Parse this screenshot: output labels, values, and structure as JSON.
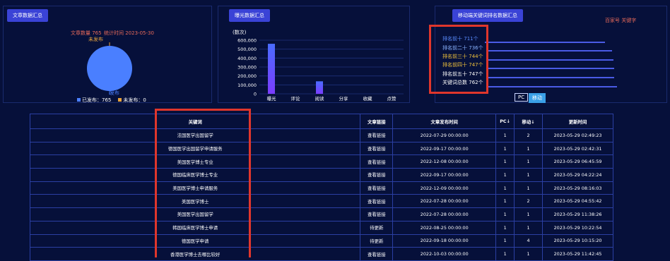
{
  "panels": {
    "articles": {
      "title": "文章数据汇总",
      "count_text": "文章数量 765",
      "stat_time_text": "统计时间 2023-05-30",
      "unpublished_label": "未发布",
      "published_label": "发布",
      "legend": [
        {
          "label": "已发布：765",
          "color": "#4a7fff"
        },
        {
          "label": "未发布：0",
          "color": "#e8a23a"
        }
      ],
      "published_count": 765,
      "unpublished_count": 0
    },
    "exposure": {
      "title": "曝光数据汇总",
      "unit_label": "(数次)"
    },
    "mobile": {
      "title": "移动端关键词排名数据汇总",
      "source_label": "百家号 关键字",
      "ranks": [
        {
          "label": "排名前十",
          "value": "711个",
          "label_color": "#5a8cff",
          "value_color": "#5a8cff"
        },
        {
          "label": "排名前二十",
          "value": "736个",
          "label_color": "#8ab3ff",
          "value_color": "#8ab3ff"
        },
        {
          "label": "排名前三十",
          "value": "744个",
          "label_color": "#f0c23b",
          "value_color": "#f0c23b"
        },
        {
          "label": "排名前四十",
          "value": "747个",
          "label_color": "#f0c23b",
          "value_color": "#f0c23b"
        },
        {
          "label": "排名前五十",
          "value": "747个",
          "label_color": "#ffffff",
          "value_color": "#ffffff"
        },
        {
          "label": "关键词总数",
          "value": "762个",
          "label_color": "#ffffff",
          "value_color": "#ffffff"
        }
      ],
      "tab_pc": "PC",
      "tab_mobile": "移动"
    }
  },
  "chart_data": {
    "type": "bar",
    "categories": [
      "曝光",
      "评论",
      "阅读",
      "分享",
      "收藏",
      "点赞"
    ],
    "values": [
      560000,
      0,
      140000,
      0,
      0,
      0
    ],
    "ylim": [
      0,
      600000
    ],
    "yticks": [
      "600,000",
      "500,000",
      "400,000",
      "300,000",
      "200,000",
      "100,000",
      "0"
    ],
    "ylabel": "(数次)",
    "grid": true
  },
  "table": {
    "headers": [
      "关键词",
      "文章链接",
      "文章发布时间",
      "PC↓",
      "移动↓",
      "更新时间"
    ],
    "rows": [
      [
        "法国医学出国留学",
        "查看链接",
        "2022-07-29 00:00:00",
        "1",
        "2",
        "2023-05-29 02:49:23"
      ],
      [
        "德国医学出国留学申请服务",
        "查看链接",
        "2022-09-17 00:00:00",
        "1",
        "1",
        "2023-05-29 02:42:31"
      ],
      [
        "美国医学博士专业",
        "查看链接",
        "2022-12-08 00:00:00",
        "1",
        "1",
        "2023-05-29 06:45:59"
      ],
      [
        "德国临床医学博士专业",
        "查看链接",
        "2022-09-17 00:00:00",
        "1",
        "1",
        "2023-05-29 04:22:24"
      ],
      [
        "美国医学博士申请服务",
        "查看链接",
        "2022-12-09 00:00:00",
        "1",
        "1",
        "2023-05-29 08:16:03"
      ],
      [
        "美国医学博士",
        "查看链接",
        "2022-07-28 00:00:00",
        "1",
        "2",
        "2023-05-29 04:55:42"
      ],
      [
        "美国医学出国留学",
        "查看链接",
        "2022-07-28 00:00:00",
        "1",
        "1",
        "2023-05-29 11:38:26"
      ],
      [
        "韩国临床医学博士申请",
        "待更新",
        "2022-08-25 00:00:00",
        "1",
        "1",
        "2023-05-29 10:22:54"
      ],
      [
        "德国医学申请",
        "待更新",
        "2022-09-18 00:00:00",
        "1",
        "4",
        "2023-05-29 10:15:20"
      ],
      [
        "香港医学博士去哪比较好",
        "查看链接",
        "2022-10-03 00:00:00",
        "1",
        "1",
        "2023-05-29 11:42:45"
      ]
    ]
  }
}
